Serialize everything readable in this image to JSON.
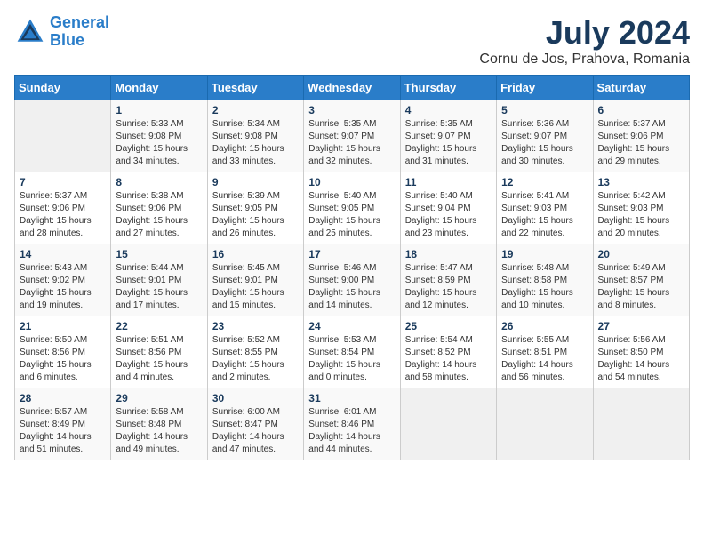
{
  "header": {
    "logo_line1": "General",
    "logo_line2": "Blue",
    "title": "July 2024",
    "subtitle": "Cornu de Jos, Prahova, Romania"
  },
  "days_of_week": [
    "Sunday",
    "Monday",
    "Tuesday",
    "Wednesday",
    "Thursday",
    "Friday",
    "Saturday"
  ],
  "weeks": [
    [
      {
        "num": "",
        "info": ""
      },
      {
        "num": "1",
        "info": "Sunrise: 5:33 AM\nSunset: 9:08 PM\nDaylight: 15 hours\nand 34 minutes."
      },
      {
        "num": "2",
        "info": "Sunrise: 5:34 AM\nSunset: 9:08 PM\nDaylight: 15 hours\nand 33 minutes."
      },
      {
        "num": "3",
        "info": "Sunrise: 5:35 AM\nSunset: 9:07 PM\nDaylight: 15 hours\nand 32 minutes."
      },
      {
        "num": "4",
        "info": "Sunrise: 5:35 AM\nSunset: 9:07 PM\nDaylight: 15 hours\nand 31 minutes."
      },
      {
        "num": "5",
        "info": "Sunrise: 5:36 AM\nSunset: 9:07 PM\nDaylight: 15 hours\nand 30 minutes."
      },
      {
        "num": "6",
        "info": "Sunrise: 5:37 AM\nSunset: 9:06 PM\nDaylight: 15 hours\nand 29 minutes."
      }
    ],
    [
      {
        "num": "7",
        "info": "Sunrise: 5:37 AM\nSunset: 9:06 PM\nDaylight: 15 hours\nand 28 minutes."
      },
      {
        "num": "8",
        "info": "Sunrise: 5:38 AM\nSunset: 9:06 PM\nDaylight: 15 hours\nand 27 minutes."
      },
      {
        "num": "9",
        "info": "Sunrise: 5:39 AM\nSunset: 9:05 PM\nDaylight: 15 hours\nand 26 minutes."
      },
      {
        "num": "10",
        "info": "Sunrise: 5:40 AM\nSunset: 9:05 PM\nDaylight: 15 hours\nand 25 minutes."
      },
      {
        "num": "11",
        "info": "Sunrise: 5:40 AM\nSunset: 9:04 PM\nDaylight: 15 hours\nand 23 minutes."
      },
      {
        "num": "12",
        "info": "Sunrise: 5:41 AM\nSunset: 9:03 PM\nDaylight: 15 hours\nand 22 minutes."
      },
      {
        "num": "13",
        "info": "Sunrise: 5:42 AM\nSunset: 9:03 PM\nDaylight: 15 hours\nand 20 minutes."
      }
    ],
    [
      {
        "num": "14",
        "info": "Sunrise: 5:43 AM\nSunset: 9:02 PM\nDaylight: 15 hours\nand 19 minutes."
      },
      {
        "num": "15",
        "info": "Sunrise: 5:44 AM\nSunset: 9:01 PM\nDaylight: 15 hours\nand 17 minutes."
      },
      {
        "num": "16",
        "info": "Sunrise: 5:45 AM\nSunset: 9:01 PM\nDaylight: 15 hours\nand 15 minutes."
      },
      {
        "num": "17",
        "info": "Sunrise: 5:46 AM\nSunset: 9:00 PM\nDaylight: 15 hours\nand 14 minutes."
      },
      {
        "num": "18",
        "info": "Sunrise: 5:47 AM\nSunset: 8:59 PM\nDaylight: 15 hours\nand 12 minutes."
      },
      {
        "num": "19",
        "info": "Sunrise: 5:48 AM\nSunset: 8:58 PM\nDaylight: 15 hours\nand 10 minutes."
      },
      {
        "num": "20",
        "info": "Sunrise: 5:49 AM\nSunset: 8:57 PM\nDaylight: 15 hours\nand 8 minutes."
      }
    ],
    [
      {
        "num": "21",
        "info": "Sunrise: 5:50 AM\nSunset: 8:56 PM\nDaylight: 15 hours\nand 6 minutes."
      },
      {
        "num": "22",
        "info": "Sunrise: 5:51 AM\nSunset: 8:56 PM\nDaylight: 15 hours\nand 4 minutes."
      },
      {
        "num": "23",
        "info": "Sunrise: 5:52 AM\nSunset: 8:55 PM\nDaylight: 15 hours\nand 2 minutes."
      },
      {
        "num": "24",
        "info": "Sunrise: 5:53 AM\nSunset: 8:54 PM\nDaylight: 15 hours\nand 0 minutes."
      },
      {
        "num": "25",
        "info": "Sunrise: 5:54 AM\nSunset: 8:52 PM\nDaylight: 14 hours\nand 58 minutes."
      },
      {
        "num": "26",
        "info": "Sunrise: 5:55 AM\nSunset: 8:51 PM\nDaylight: 14 hours\nand 56 minutes."
      },
      {
        "num": "27",
        "info": "Sunrise: 5:56 AM\nSunset: 8:50 PM\nDaylight: 14 hours\nand 54 minutes."
      }
    ],
    [
      {
        "num": "28",
        "info": "Sunrise: 5:57 AM\nSunset: 8:49 PM\nDaylight: 14 hours\nand 51 minutes."
      },
      {
        "num": "29",
        "info": "Sunrise: 5:58 AM\nSunset: 8:48 PM\nDaylight: 14 hours\nand 49 minutes."
      },
      {
        "num": "30",
        "info": "Sunrise: 6:00 AM\nSunset: 8:47 PM\nDaylight: 14 hours\nand 47 minutes."
      },
      {
        "num": "31",
        "info": "Sunrise: 6:01 AM\nSunset: 8:46 PM\nDaylight: 14 hours\nand 44 minutes."
      },
      {
        "num": "",
        "info": ""
      },
      {
        "num": "",
        "info": ""
      },
      {
        "num": "",
        "info": ""
      }
    ]
  ]
}
